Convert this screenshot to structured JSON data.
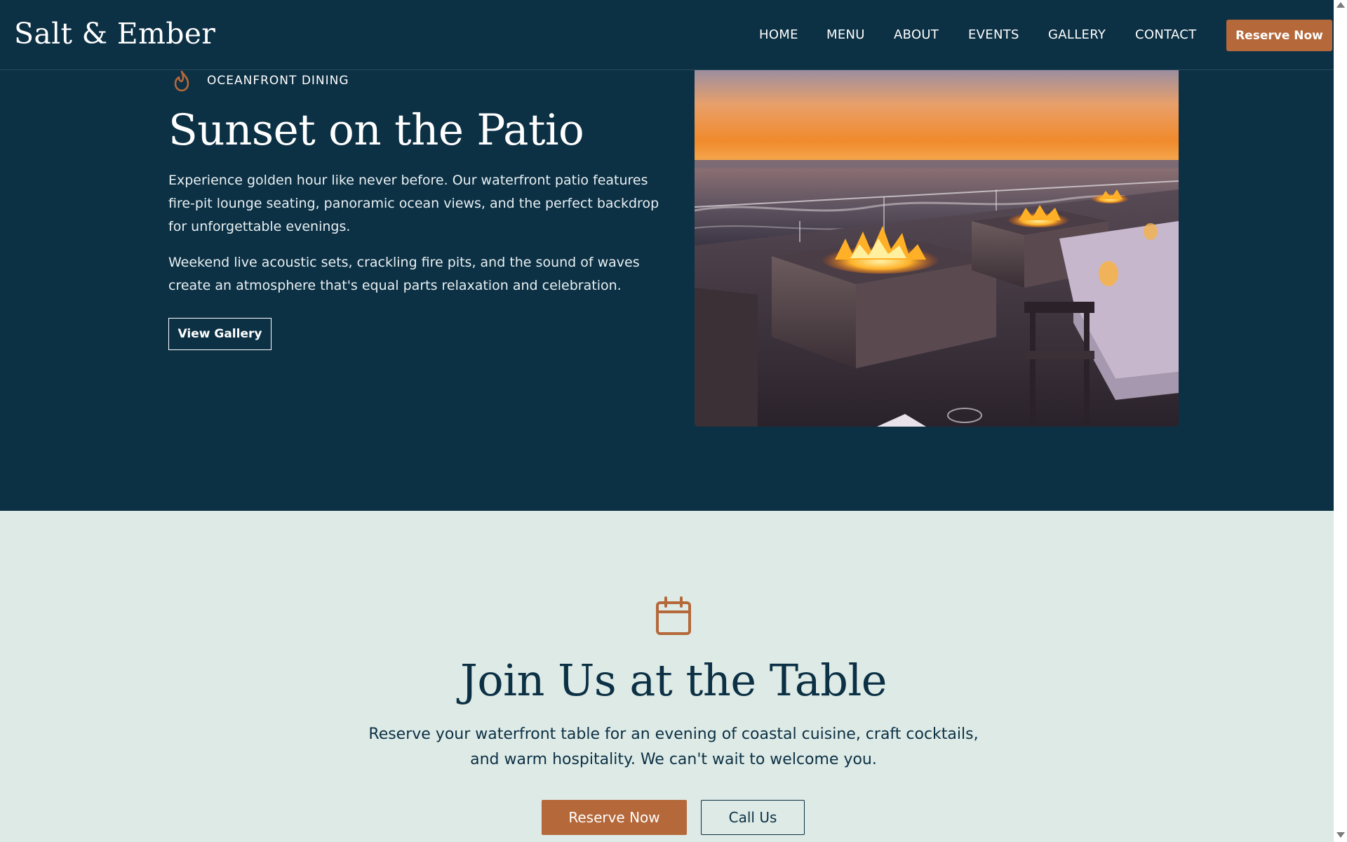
{
  "header": {
    "logo": "Salt & Ember",
    "nav": [
      "HOME",
      "MENU",
      "ABOUT",
      "EVENTS",
      "GALLERY",
      "CONTACT"
    ],
    "reserve_label": "Reserve Now"
  },
  "patio": {
    "eyebrow_icon": "flame-icon",
    "eyebrow": "OCEANFRONT DINING",
    "title": "Sunset on the Patio",
    "paragraph1": "Experience golden hour like never before. Our waterfront patio features fire-pit lounge seating, panoramic ocean views, and the perfect backdrop for unforgettable evenings.",
    "paragraph2": "Weekend live acoustic sets, crackling fire pits, and the sound of waves create an atmosphere that's equal parts relaxation and celebration.",
    "gallery_button": "View Gallery"
  },
  "cta": {
    "icon": "calendar-icon",
    "title": "Join Us at the Table",
    "text": "Reserve your waterfront table for an evening of coastal cuisine, craft cocktails, and warm hospitality. We can't wait to welcome you.",
    "reserve_button": "Reserve Now",
    "call_button": "Call Us"
  },
  "colors": {
    "navy": "#0c3044",
    "accent": "#b5683a",
    "mint": "#ddeae6",
    "white": "#ffffff"
  }
}
